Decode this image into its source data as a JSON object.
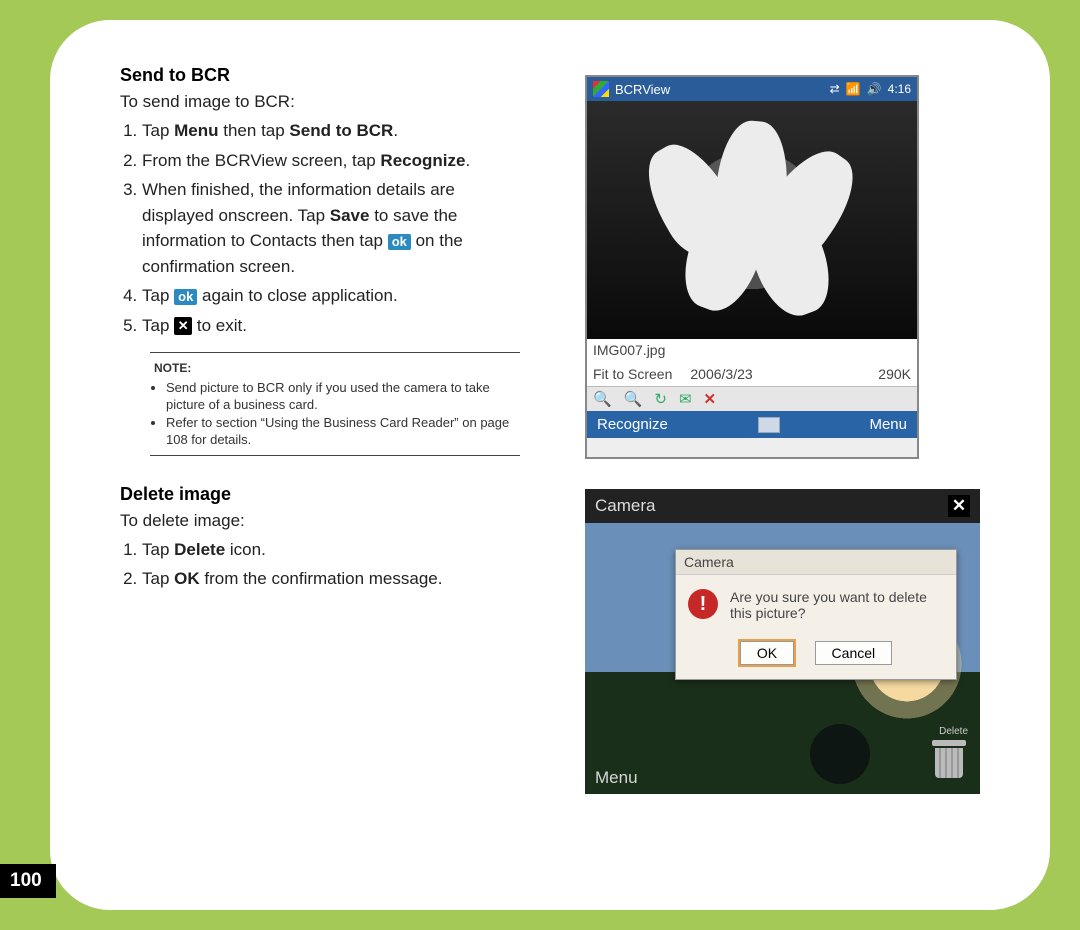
{
  "page_number": "100",
  "section1": {
    "heading": "Send to BCR",
    "intro": "To send image to BCR:",
    "step1_a": "Tap ",
    "step1_b": "Menu",
    "step1_c": " then tap ",
    "step1_d": "Send to BCR",
    "step1_e": ".",
    "step2_a": "From the BCRView screen, tap ",
    "step2_b": "Recognize",
    "step2_c": ".",
    "step3_a": "When finished, the information details are displayed onscreen. Tap ",
    "step3_b": "Save",
    "step3_c": " to save the information to Contacts then tap ",
    "step3_ok": "ok",
    "step3_d": " on the confirmation screen.",
    "step4_a": "Tap ",
    "step4_ok": "ok",
    "step4_b": " again to close application.",
    "step5_a": "Tap ",
    "step5_b": " to exit."
  },
  "note": {
    "label": "NOTE:",
    "item1": "Send picture to BCR only if you used the camera to take picture of a business card.",
    "item2": "Refer to section “Using the Business Card Reader” on page 108 for details."
  },
  "section2": {
    "heading": "Delete image",
    "intro": "To delete image:",
    "step1_a": "Tap ",
    "step1_b": "Delete",
    "step1_c": " icon.",
    "step2_a": "Tap ",
    "step2_b": "OK",
    "step2_c": " from the confirmation message."
  },
  "scr1": {
    "title": "BCRView",
    "time": "4:16",
    "filename": "IMG007.jpg",
    "fit": "Fit to Screen",
    "date": "2006/3/23",
    "size": "290K",
    "soft_left": "Recognize",
    "soft_right": "Menu"
  },
  "scr2": {
    "title": "Camera",
    "dialog_title": "Camera",
    "dialog_msg": "Are you sure you want to delete this picture?",
    "ok": "OK",
    "cancel": "Cancel",
    "menu": "Menu",
    "trash_label": "Delete"
  }
}
